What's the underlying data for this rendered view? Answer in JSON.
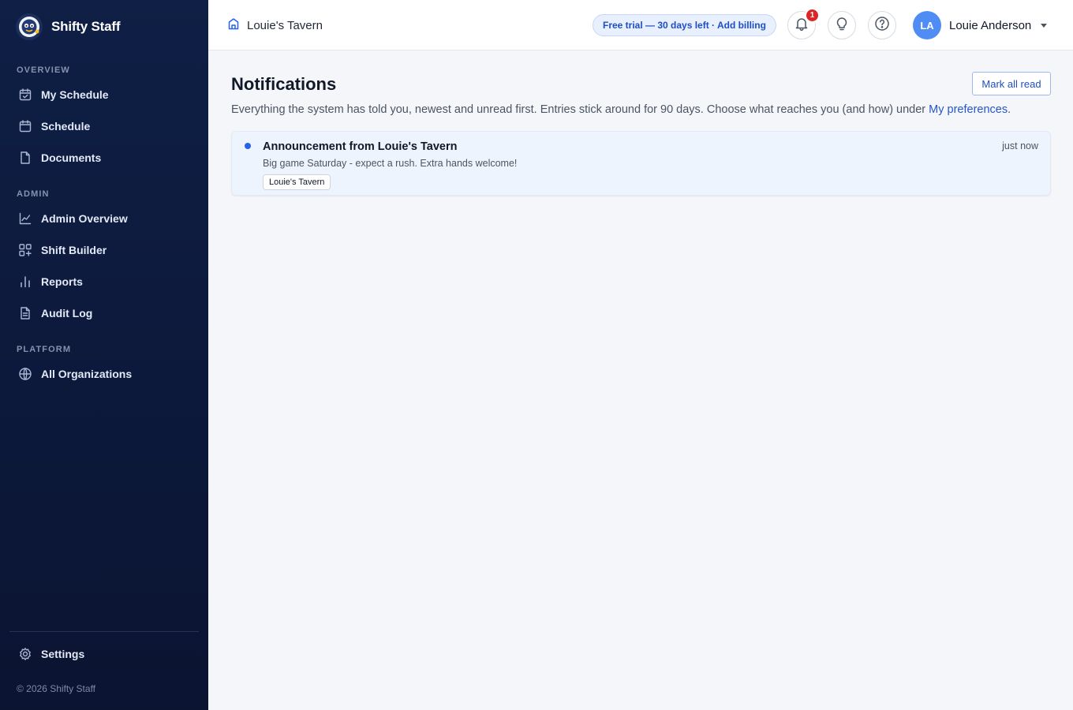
{
  "brand": {
    "name": "Shifty Staff"
  },
  "sidebar": {
    "sections": [
      {
        "label": "OVERVIEW",
        "items": [
          {
            "label": "My Schedule",
            "icon": "calendar-check-icon"
          },
          {
            "label": "Schedule",
            "icon": "calendar-icon"
          },
          {
            "label": "Documents",
            "icon": "document-icon"
          }
        ]
      },
      {
        "label": "ADMIN",
        "items": [
          {
            "label": "Admin Overview",
            "icon": "line-chart-icon"
          },
          {
            "label": "Shift Builder",
            "icon": "grid-plus-icon"
          },
          {
            "label": "Reports",
            "icon": "bar-chart-icon"
          },
          {
            "label": "Audit Log",
            "icon": "file-text-icon"
          }
        ]
      },
      {
        "label": "PLATFORM",
        "items": [
          {
            "label": "All Organizations",
            "icon": "globe-icon"
          }
        ]
      }
    ],
    "settings_label": "Settings",
    "copyright": "© 2026 Shifty Staff"
  },
  "topbar": {
    "org_name": "Louie's Tavern",
    "trial_text": "Free trial — 30 days left · Add billing",
    "notification_count": "1",
    "user": {
      "initials": "LA",
      "name": "Louie Anderson"
    }
  },
  "main": {
    "title": "Notifications",
    "mark_all_read": "Mark all read",
    "subtitle_text": "Everything the system has told you, newest and unread first. Entries stick around for 90 days. Choose what reaches you (and how) under ",
    "subtitle_link": "My preferences",
    "subtitle_end": ".",
    "notifications": [
      {
        "title": "Announcement from Louie's Tavern",
        "body": "Big game Saturday - expect a rush. Extra hands welcome!",
        "tag": "Louie's Tavern",
        "time": "just now",
        "unread": true
      }
    ]
  },
  "colors": {
    "sidebar_bg": "#0f1f45",
    "accent": "#2563eb",
    "badge": "#dc2626",
    "avatar": "#4f8df5"
  }
}
